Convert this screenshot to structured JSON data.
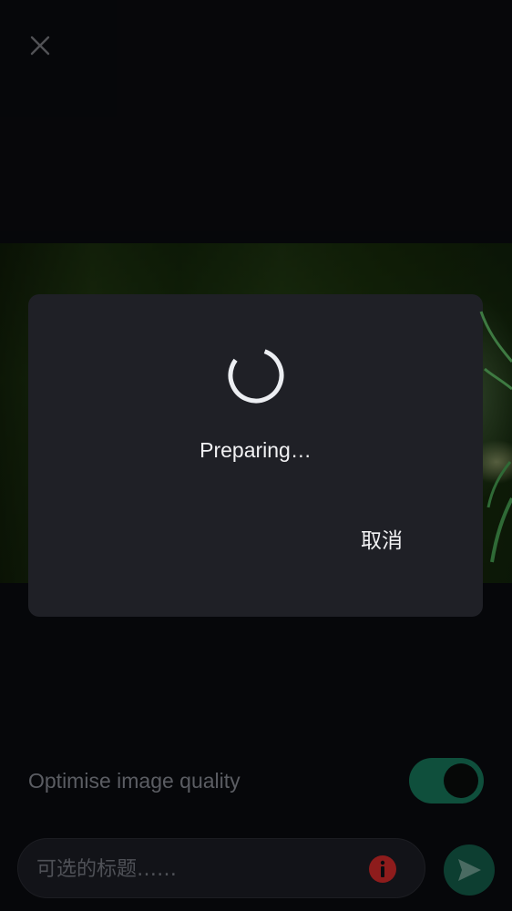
{
  "icons": {
    "close": "close-icon",
    "info": "info-icon",
    "send": "send-icon",
    "spinner": "loading-spinner"
  },
  "colors": {
    "toggle_on": "#0f4f3c",
    "send_button": "#0d3e31",
    "info_badge": "#8e1c1c",
    "dialog_background": "#1f2026"
  },
  "options": {
    "optimise_label": "Optimise image quality",
    "optimise_enabled": true
  },
  "caption": {
    "placeholder": "可选的标题……",
    "value": ""
  },
  "dialog": {
    "message": "Preparing…",
    "cancel_label": "取消"
  }
}
